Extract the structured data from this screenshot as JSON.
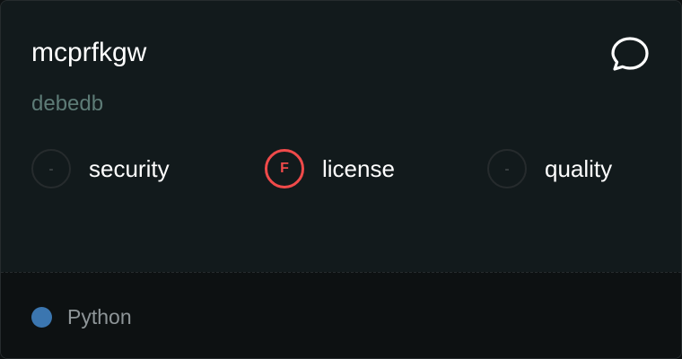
{
  "repo": {
    "name": "mcprfkgw",
    "owner": "debedb"
  },
  "actions": {
    "comment_icon": "chat-bubble-icon"
  },
  "metrics": [
    {
      "label": "security",
      "grade": "-",
      "status": "unknown"
    },
    {
      "label": "license",
      "grade": "F",
      "status": "fail",
      "color": "#f04a4a"
    },
    {
      "label": "quality",
      "grade": "-",
      "status": "unknown"
    }
  ],
  "footer": {
    "language": "Python",
    "language_color": "#3b76b0"
  }
}
